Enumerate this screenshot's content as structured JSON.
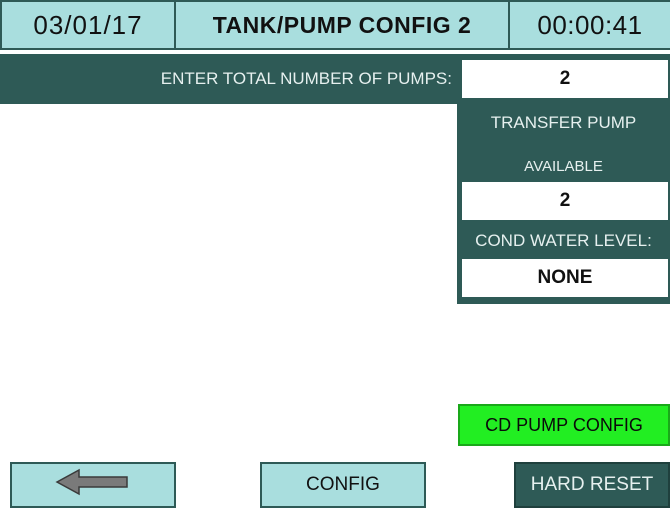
{
  "header": {
    "date": "03/01/17",
    "title": "TANK/PUMP CONFIG 2",
    "time": "00:00:41"
  },
  "pumps": {
    "label": "ENTER TOTAL NUMBER OF PUMPS:",
    "value": "2"
  },
  "transfer_pump": {
    "label_line1": "TRANSFER PUMP",
    "label_line2": "AVAILABLE",
    "value": "2"
  },
  "cond_water": {
    "label": "COND WATER LEVEL:",
    "value": "NONE"
  },
  "buttons": {
    "cd_pump_config": "CD PUMP CONFIG",
    "back_icon": "left-arrow-icon",
    "config": "CONFIG",
    "hard_reset": "HARD RESET"
  },
  "colors": {
    "header_bg": "#a9dede",
    "panel_bg": "#2e5a56",
    "cd_pump_green": "#22ee22"
  }
}
